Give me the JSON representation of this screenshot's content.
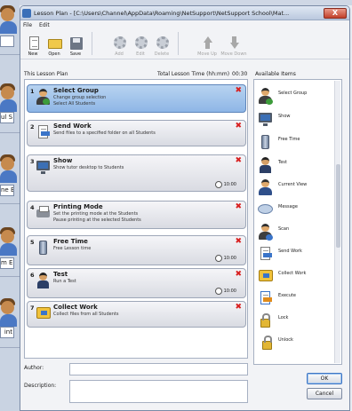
{
  "background": {
    "labels": [
      "",
      "ul S",
      "ne E",
      "m E",
      "int"
    ]
  },
  "window": {
    "title": "Lesson Plan - [C:\\Users\\Channel\\AppData\\Roaming\\NetSupport\\NetSupport School\\Mat...",
    "close_label": "X"
  },
  "menu": {
    "file": "File",
    "edit": "Edit"
  },
  "toolbar": {
    "new": "New",
    "open": "Open",
    "save": "Save",
    "add": "Add",
    "edit": "Edit",
    "delete": "Delete",
    "move_up": "Move Up",
    "move_down": "Move Down"
  },
  "plan": {
    "header": "This Lesson Plan",
    "total_time_label": "Total Lesson Time (hh:mm)",
    "total_time": "00:30"
  },
  "steps": [
    {
      "num": "1",
      "name": "Select Group",
      "d1": "Change group selection",
      "d2": "Select All Students",
      "time": "",
      "icon": "select-group-icon",
      "selected": true
    },
    {
      "num": "2",
      "name": "Send Work",
      "d1": "Send files to a specified folder on all Students",
      "d2": "",
      "time": "",
      "icon": "send-work-icon"
    },
    {
      "num": "3",
      "name": "Show",
      "d1": "Show tutor desktop to Students",
      "d2": "",
      "time": "10:00",
      "icon": "show-icon"
    },
    {
      "num": "4",
      "name": "Printing Mode",
      "d1": "Set the printing mode at the Students",
      "d2": "Pause printing at the selected Students",
      "time": "",
      "icon": "printer-icon"
    },
    {
      "num": "5",
      "name": "Free Time",
      "d1": "Free Lesson time",
      "d2": "",
      "time": "10:00",
      "icon": "free-time-icon"
    },
    {
      "num": "6",
      "name": "Test",
      "d1": "Run a Test",
      "d2": "",
      "time": "10:00",
      "icon": "test-icon"
    },
    {
      "num": "7",
      "name": "Collect Work",
      "d1": "Collect files from all Students",
      "d2": "",
      "time": "",
      "icon": "collect-work-icon"
    }
  ],
  "available": {
    "header": "Available Items",
    "items": [
      {
        "label": "Select Group",
        "icon": "select-group-icon"
      },
      {
        "label": "Show",
        "icon": "show-icon"
      },
      {
        "label": "Free Time",
        "icon": "free-time-icon"
      },
      {
        "label": "Test",
        "icon": "test-icon"
      },
      {
        "label": "Current View",
        "icon": "current-view-icon"
      },
      {
        "label": "Message",
        "icon": "message-icon"
      },
      {
        "label": "Scan",
        "icon": "scan-icon"
      },
      {
        "label": "Send Work",
        "icon": "send-work-icon"
      },
      {
        "label": "Collect Work",
        "icon": "collect-work-icon"
      },
      {
        "label": "Execute",
        "icon": "execute-icon"
      },
      {
        "label": "Lock",
        "icon": "lock-icon"
      },
      {
        "label": "Unlock",
        "icon": "unlock-icon"
      }
    ]
  },
  "fields": {
    "author_label": "Author:",
    "author_value": "",
    "description_label": "Description:",
    "description_value": ""
  },
  "buttons": {
    "ok": "OK",
    "cancel": "Cancel"
  },
  "colors": {
    "selected_step": "#8eb6e6",
    "delete_x": "#d82020",
    "title_bar": "#bac8de"
  }
}
